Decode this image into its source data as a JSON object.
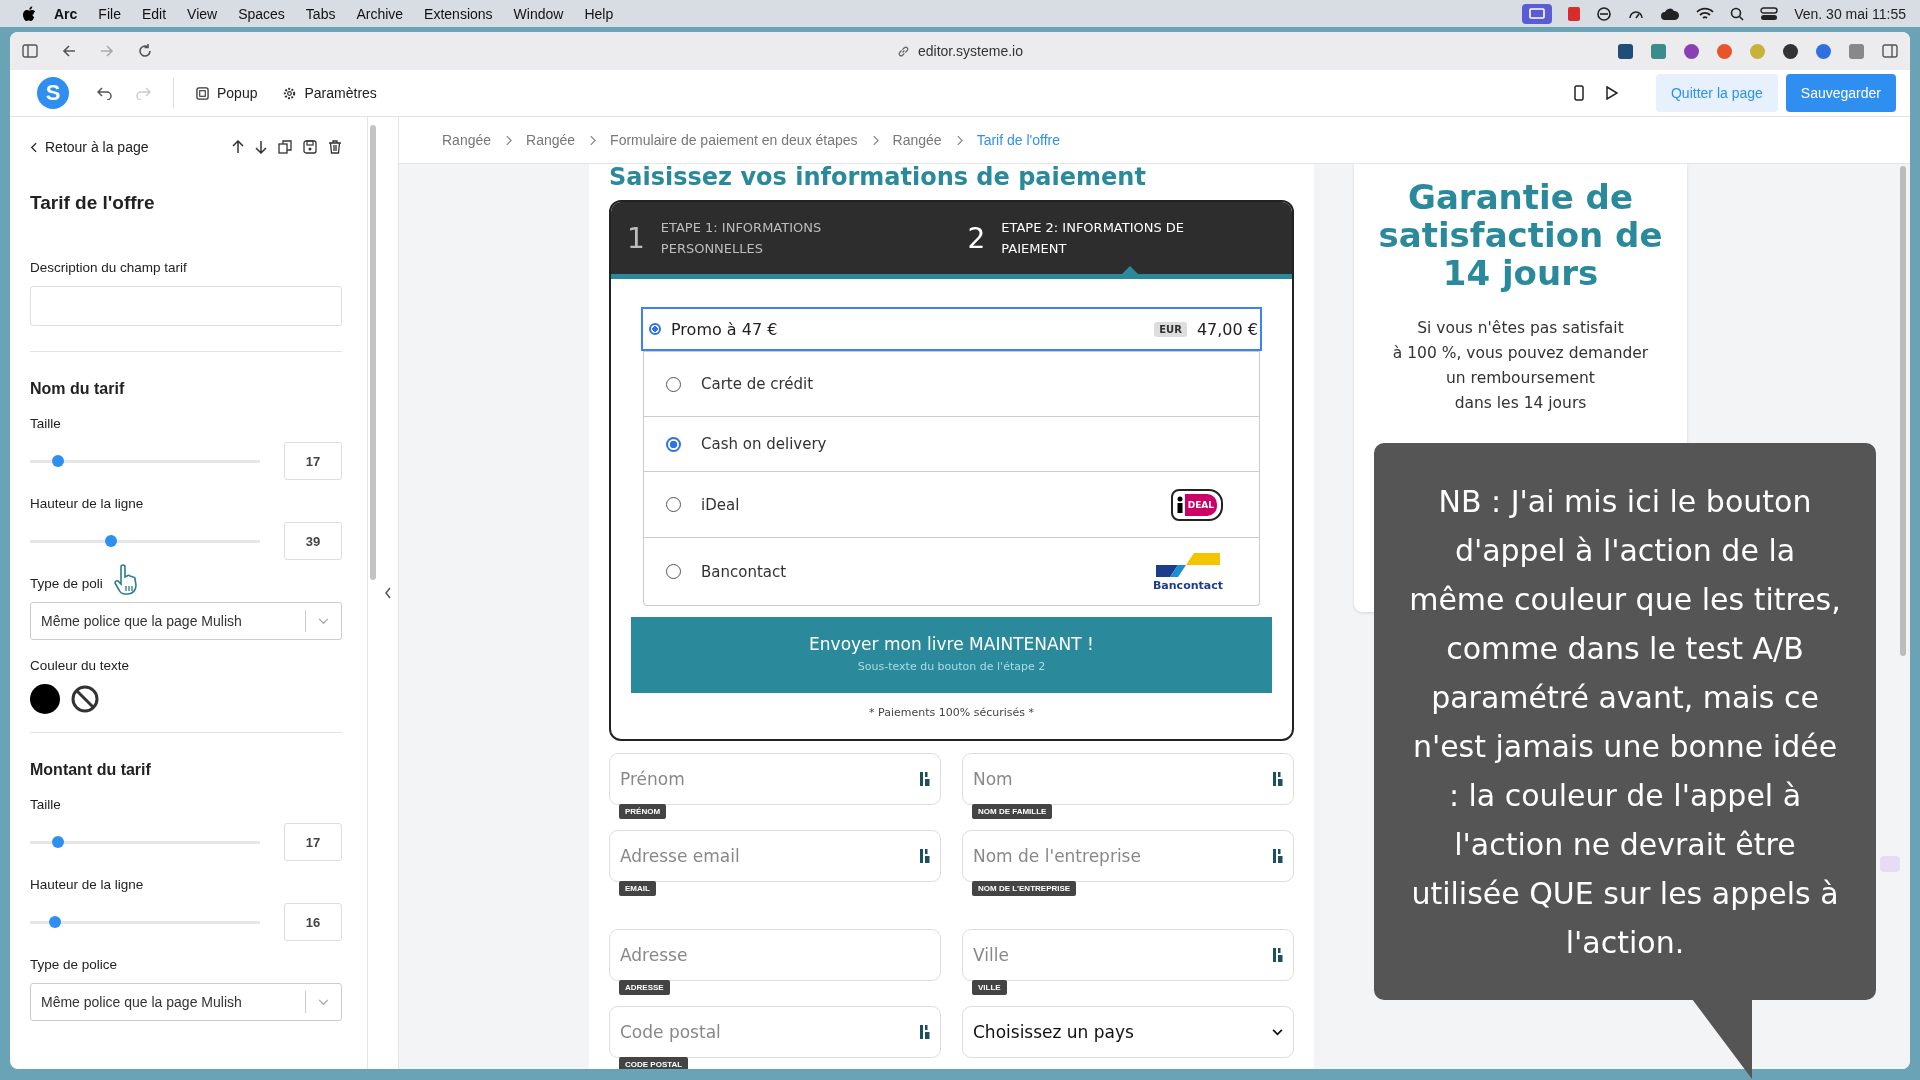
{
  "menubar": {
    "app": "Arc",
    "menus": [
      "File",
      "Edit",
      "View",
      "Spaces",
      "Tabs",
      "Archive",
      "Extensions",
      "Window",
      "Help"
    ],
    "clock": "Ven. 30 mai 11:55"
  },
  "browser": {
    "url": "editor.systeme.io"
  },
  "editor_header": {
    "logo": "S",
    "popup": "Popup",
    "settings": "Paramètres",
    "quit": "Quitter la page",
    "save": "Sauvegarder"
  },
  "left_panel": {
    "back": "Retour à la page",
    "title": "Tarif de l'offre",
    "description_label": "Description du champ tarif",
    "sections": [
      {
        "title": "Nom du tarif",
        "controls": [
          {
            "kind": "slider",
            "label": "Taille",
            "level": 0.12,
            "value": "17"
          },
          {
            "kind": "slider",
            "label": "Hauteur de la ligne",
            "level": 0.35,
            "value": "39"
          },
          {
            "kind": "select",
            "label": "Type de poli",
            "value": "Même police que la page Mulish"
          },
          {
            "kind": "colors",
            "label": "Couleur du texte"
          }
        ]
      },
      {
        "title": "Montant du tarif",
        "controls": [
          {
            "kind": "slider",
            "label": "Taille",
            "level": 0.12,
            "value": "17"
          },
          {
            "kind": "slider",
            "label": "Hauteur de la ligne",
            "level": 0.11,
            "value": "16"
          },
          {
            "kind": "select",
            "label": "Type de police",
            "value": "Même police que la page Mulish"
          }
        ]
      }
    ]
  },
  "breadcrumb": [
    {
      "label": "Rangée",
      "selected": false
    },
    {
      "label": "Rangée",
      "selected": false
    },
    {
      "label": "Formulaire de paiement en deux étapes",
      "selected": false
    },
    {
      "label": "Rangée",
      "selected": false
    },
    {
      "label": "Tarif de l'offre",
      "selected": true
    }
  ],
  "payment": {
    "heading": "Saisissez vos informations de paiement",
    "steps": [
      {
        "number": "1",
        "label": "ETAPE 1: INFORMATIONS PERSONNELLES",
        "selected": false
      },
      {
        "number": "2",
        "label": "ETAPE 2: INFORMATIONS DE PAIEMENT",
        "selected": true
      }
    ],
    "offer": {
      "name": "Promo à 47 €",
      "selected": true,
      "currency": "EUR",
      "price": "47,00 €"
    },
    "methods": [
      {
        "label": "Carte de crédit",
        "selected": false,
        "kind": "plain"
      },
      {
        "label": "Cash on delivery",
        "selected": true,
        "kind": "plain"
      },
      {
        "label": "iDeal",
        "selected": false,
        "kind": "ideal",
        "logo_text": "DEAL"
      },
      {
        "label": "Bancontact",
        "selected": false,
        "kind": "bancontact",
        "logo_text": "Bancontact"
      }
    ],
    "cta": {
      "title": "Envoyer mon livre MAINTENANT !",
      "subtitle": "Sous-texte du bouton de l'étape 2"
    },
    "secure_note": "* Paiements 100% sécurisés *",
    "fields": [
      {
        "placeholder": "Prénom",
        "tag": "PRÉNOM",
        "icon": true
      },
      {
        "placeholder": "Nom",
        "tag": "NOM DE FAMILLE",
        "icon": true
      },
      {
        "placeholder": "Adresse email",
        "tag": "EMAIL",
        "icon": true
      },
      {
        "placeholder": "Nom de l'entreprise",
        "tag": "NOM DE L'ENTREPRISE",
        "icon": true
      },
      {
        "placeholder": "Adresse",
        "tag": "ADRESSE",
        "icon": false
      },
      {
        "placeholder": "Ville",
        "tag": "VILLE",
        "icon": true
      },
      {
        "placeholder": "Code postal",
        "tag": "CODE POSTAL",
        "icon": true
      }
    ],
    "country": "Choisissez un pays"
  },
  "guarantee": {
    "title": "Garantie de satisfaction de 14 jours",
    "lines": [
      "Si vous n'êtes pas satisfait",
      "à 100 %, vous pouvez demander",
      "un remboursement",
      "dans les 14 jours"
    ]
  },
  "callout": "NB : J'ai mis ici le bouton d'appel à l'action de la même couleur que les titres, comme dans le test A/B paramétré avant, mais ce n'est jamais une bonne idée : la couleur de l'appel à l'action ne devrait être utilisée QUE sur les appels à l'action."
}
